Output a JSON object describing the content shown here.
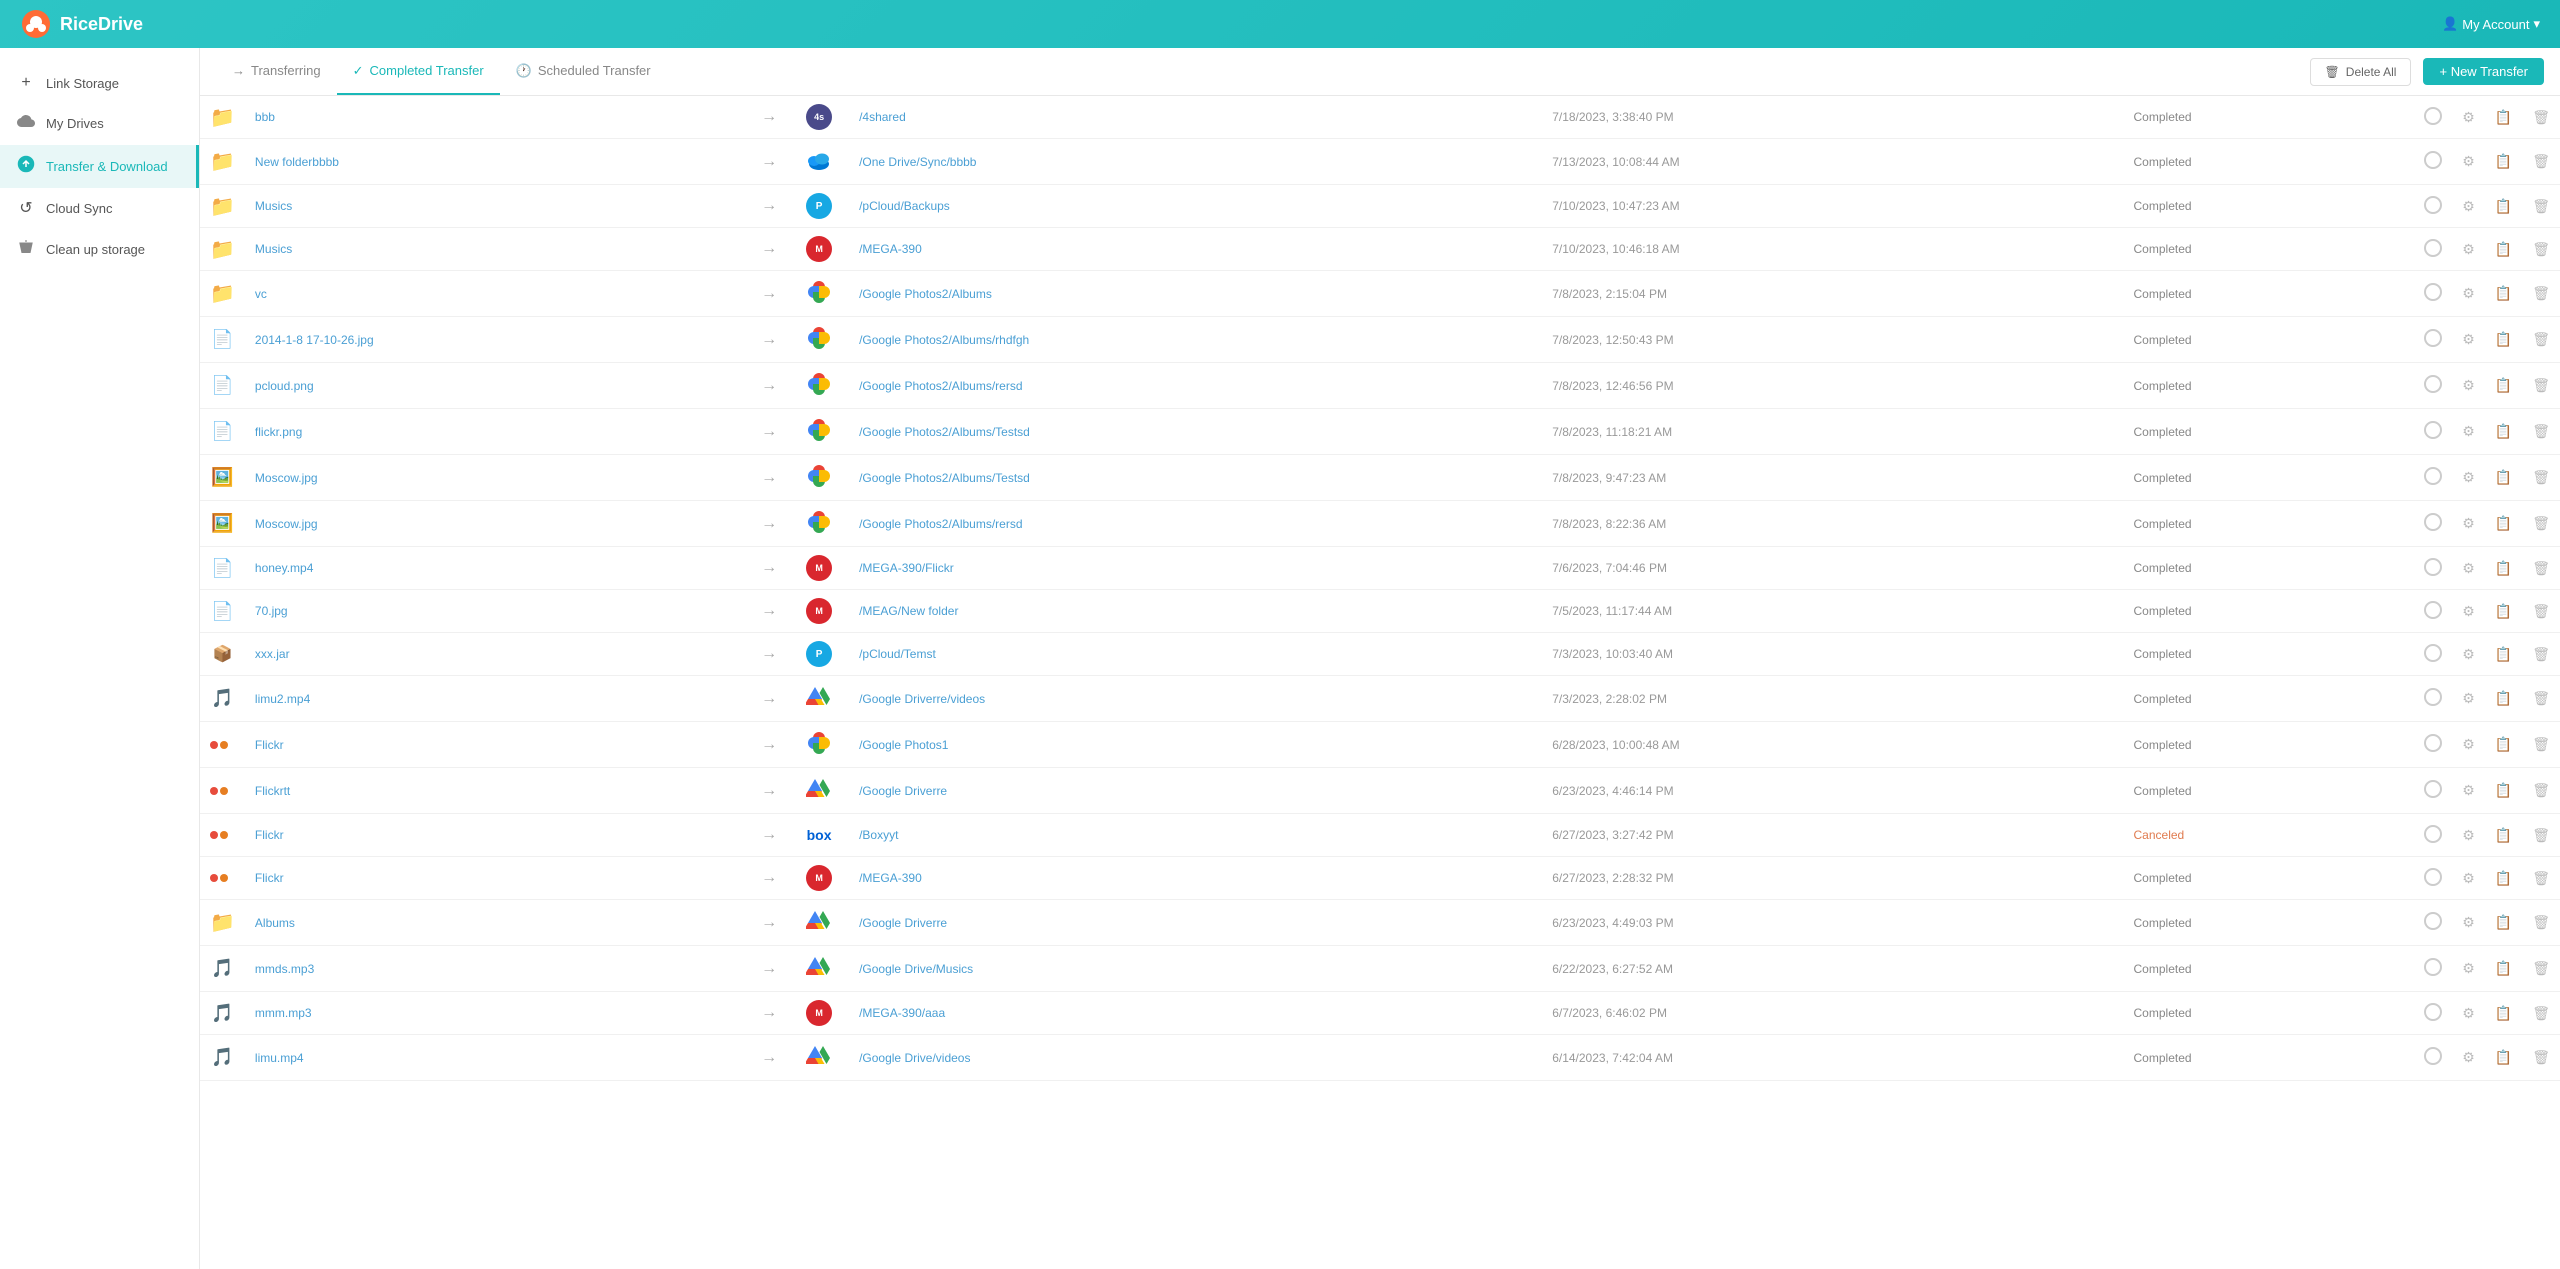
{
  "header": {
    "logo_text": "RiceDrive",
    "account_label": "My Account"
  },
  "sidebar": {
    "items": [
      {
        "id": "link-storage",
        "label": "Link Storage",
        "icon": "+"
      },
      {
        "id": "my-drives",
        "label": "My Drives",
        "icon": "☁"
      },
      {
        "id": "transfer-download",
        "label": "Transfer & Download",
        "icon": "⬇",
        "active": true
      },
      {
        "id": "cloud-sync",
        "label": "Cloud Sync",
        "icon": "↺"
      },
      {
        "id": "clean-up",
        "label": "Clean up storage",
        "icon": "🧹"
      }
    ]
  },
  "tabs": {
    "items": [
      {
        "id": "transferring",
        "label": "Transferring",
        "active": false
      },
      {
        "id": "completed-transfer",
        "label": "Completed Transfer",
        "active": true
      },
      {
        "id": "scheduled-transfer",
        "label": "Scheduled Transfer",
        "active": false
      }
    ],
    "delete_all_label": "Delete All",
    "new_transfer_label": "+ New Transfer"
  },
  "table": {
    "rows": [
      {
        "id": 1,
        "file_type": "folder",
        "file_name": "bbb",
        "src_svc": "4shared",
        "dest_svc_type": "num",
        "dest_num": "4",
        "dest_path": "/4shared",
        "date": "7/18/2023, 3:38:40 PM",
        "status": "Completed"
      },
      {
        "id": 2,
        "file_type": "folder",
        "file_name": "New folderbbbb",
        "src_svc": "onedrive",
        "dest_svc_type": "onedrive",
        "dest_path": "/One Drive/Sync/bbbb",
        "date": "7/13/2023, 10:08:44 AM",
        "status": "Completed"
      },
      {
        "id": 3,
        "file_type": "folder",
        "file_name": "Musics",
        "src_svc": "pcloud",
        "dest_svc_type": "pcloud",
        "dest_path": "/pCloud/Backups",
        "date": "7/10/2023, 10:47:23 AM",
        "status": "Completed"
      },
      {
        "id": 4,
        "file_type": "folder",
        "file_name": "Musics",
        "src_svc": "mega",
        "dest_svc_type": "mega",
        "dest_path": "/MEGA-390",
        "date": "7/10/2023, 10:46:18 AM",
        "status": "Completed"
      },
      {
        "id": 5,
        "file_type": "folder",
        "file_name": "vc",
        "src_svc": "gphotos",
        "dest_svc_type": "gphotos",
        "dest_path": "/Google Photos2/Albums",
        "date": "7/8/2023, 2:15:04 PM",
        "status": "Completed"
      },
      {
        "id": 6,
        "file_type": "document",
        "file_name": "2014-1-8 17-10-26.jpg",
        "src_svc": "gphotos",
        "dest_svc_type": "gphotos",
        "dest_path": "/Google Photos2/Albums/rhdfgh",
        "date": "7/8/2023, 12:50:43 PM",
        "status": "Completed"
      },
      {
        "id": 7,
        "file_type": "document",
        "file_name": "pcloud.png",
        "src_svc": "gphotos",
        "dest_svc_type": "gphotos",
        "dest_path": "/Google Photos2/Albums/rersd",
        "date": "7/8/2023, 12:46:56 PM",
        "status": "Completed"
      },
      {
        "id": 8,
        "file_type": "document",
        "file_name": "flickr.png",
        "src_svc": "gphotos",
        "dest_svc_type": "gphotos",
        "dest_path": "/Google Photos2/Albums/Testsd",
        "date": "7/8/2023, 11:18:21 AM",
        "status": "Completed"
      },
      {
        "id": 9,
        "file_type": "image",
        "file_name": "Moscow.jpg",
        "src_svc": "gphotos",
        "dest_svc_type": "gphotos",
        "dest_path": "/Google Photos2/Albums/Testsd",
        "date": "7/8/2023, 9:47:23 AM",
        "status": "Completed"
      },
      {
        "id": 10,
        "file_type": "image",
        "file_name": "Moscow.jpg",
        "src_svc": "gphotos",
        "dest_svc_type": "gphotos",
        "dest_path": "/Google Photos2/Albums/rersd",
        "date": "7/8/2023, 8:22:36 AM",
        "status": "Completed"
      },
      {
        "id": 11,
        "file_type": "document",
        "file_name": "honey.mp4",
        "src_svc": "mega",
        "dest_svc_type": "mega",
        "dest_path": "/MEGA-390/Flickr",
        "date": "7/6/2023, 7:04:46 PM",
        "status": "Completed"
      },
      {
        "id": 12,
        "file_type": "document",
        "file_name": "70.jpg",
        "src_svc": "mega",
        "dest_svc_type": "mega",
        "dest_path": "/MEAG/New folder",
        "date": "7/5/2023, 11:17:44 AM",
        "status": "Completed"
      },
      {
        "id": 13,
        "file_type": "archive",
        "file_name": "xxx.jar",
        "src_svc": "pcloud",
        "dest_svc_type": "pcloud",
        "dest_path": "/pCloud/Temst",
        "date": "7/3/2023, 10:03:40 AM",
        "status": "Completed"
      },
      {
        "id": 14,
        "file_type": "audio",
        "file_name": "limu2.mp4",
        "src_svc": "gdrive",
        "dest_svc_type": "gdrive",
        "dest_path": "/Google Driverre/videos",
        "date": "7/3/2023, 2:28:02 PM",
        "status": "Completed"
      },
      {
        "id": 15,
        "file_type": "multi",
        "file_name": "Flickr",
        "src_svc": "gphotos",
        "dest_svc_type": "gphotos_alt",
        "dest_path": "/Google Photos1",
        "date": "6/28/2023, 10:00:48 AM",
        "status": "Completed"
      },
      {
        "id": 16,
        "file_type": "multi",
        "file_name": "Flickrtt",
        "src_svc": "gdrive",
        "dest_svc_type": "gdrive",
        "dest_path": "/Google Driverre",
        "date": "6/23/2023, 4:46:14 PM",
        "status": "Completed"
      },
      {
        "id": 17,
        "file_type": "multi",
        "file_name": "Flickr",
        "src_svc": "box",
        "dest_svc_type": "box",
        "dest_path": "/Boxyyt",
        "date": "6/27/2023, 3:27:42 PM",
        "status": "Canceled"
      },
      {
        "id": 18,
        "file_type": "multi",
        "file_name": "Flickr",
        "src_svc": "mega",
        "dest_svc_type": "mega",
        "dest_path": "/MEGA-390",
        "date": "6/27/2023, 2:28:32 PM",
        "status": "Completed"
      },
      {
        "id": 19,
        "file_type": "folder",
        "file_name": "Albums",
        "src_svc": "gdrive",
        "dest_svc_type": "gdrive",
        "dest_path": "/Google Driverre",
        "date": "6/23/2023, 4:49:03 PM",
        "status": "Completed"
      },
      {
        "id": 20,
        "file_type": "audio",
        "file_name": "mmds.mp3",
        "src_svc": "gdrive",
        "dest_svc_type": "gdrive",
        "dest_path": "/Google Drive/Musics",
        "date": "6/22/2023, 6:27:52 AM",
        "status": "Completed"
      },
      {
        "id": 21,
        "file_type": "audio",
        "file_name": "mmm.mp3",
        "src_svc": "mega",
        "dest_svc_type": "mega",
        "dest_path": "/MEGA-390/aaa",
        "date": "6/7/2023, 6:46:02 PM",
        "status": "Completed"
      },
      {
        "id": 22,
        "file_type": "audio",
        "file_name": "limu.mp4",
        "src_svc": "gdrive",
        "dest_svc_type": "gdrive",
        "dest_path": "/Google Drive/videos",
        "date": "6/14/2023, 7:42:04 AM",
        "status": "Completed"
      }
    ]
  }
}
